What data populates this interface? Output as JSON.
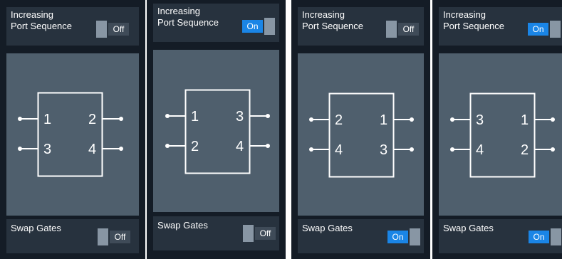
{
  "panels": [
    {
      "header": {
        "line1": "Increasing",
        "line2": "Port Sequence",
        "toggle_label": "Off",
        "toggle_on": false
      },
      "ports": {
        "left_top": "1",
        "left_bottom": "3",
        "right_top": "2",
        "right_bottom": "4"
      },
      "footer": {
        "label": "Swap Gates",
        "toggle_label": "Off",
        "toggle_on": false
      }
    },
    {
      "header": {
        "line1": "Increasing",
        "line2": "Port Sequence",
        "toggle_label": "On",
        "toggle_on": true
      },
      "ports": {
        "left_top": "1",
        "left_bottom": "2",
        "right_top": "3",
        "right_bottom": "4"
      },
      "footer": {
        "label": "Swap Gates",
        "toggle_label": "Off",
        "toggle_on": false
      }
    },
    {
      "header": {
        "line1": "Increasing",
        "line2": "Port Sequence",
        "toggle_label": "Off",
        "toggle_on": false
      },
      "ports": {
        "left_top": "2",
        "left_bottom": "4",
        "right_top": "1",
        "right_bottom": "3"
      },
      "footer": {
        "label": "Swap Gates",
        "toggle_label": "On",
        "toggle_on": true
      }
    },
    {
      "header": {
        "line1": "Increasing",
        "line2": "Port Sequence",
        "toggle_label": "On",
        "toggle_on": true
      },
      "ports": {
        "left_top": "3",
        "left_bottom": "4",
        "right_top": "1",
        "right_bottom": "2"
      },
      "footer": {
        "label": "Swap Gates",
        "toggle_label": "On",
        "toggle_on": true
      }
    }
  ],
  "colors": {
    "panel_bg": "#141c26",
    "box_bg": "#27323e",
    "diagram_bg": "#4f5f6d",
    "toggle_on": "#1a85e6",
    "toggle_off": "#3f4b58",
    "knob": "#8896a4"
  }
}
